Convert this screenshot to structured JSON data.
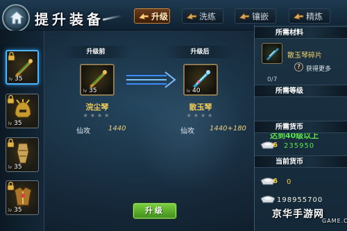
{
  "header": {
    "title": "提升装备",
    "tabs": [
      {
        "label": "升级",
        "active": true
      },
      {
        "label": "洗练",
        "active": false
      },
      {
        "label": "镶嵌",
        "active": false
      },
      {
        "label": "精炼",
        "active": false
      }
    ]
  },
  "inventory": [
    {
      "level": "35",
      "selected": true
    },
    {
      "level": "35",
      "selected": false
    },
    {
      "level": "35",
      "selected": false
    },
    {
      "level": "35",
      "selected": false
    }
  ],
  "upgrade": {
    "before": {
      "section_label": "升级前",
      "level": "35",
      "name": "浣尘琴",
      "stars": "★★★★",
      "stat_label": "仙攻",
      "stat_value": "1440"
    },
    "after": {
      "section_label": "升级后",
      "level": "40",
      "name": "散玉琴",
      "stars": "★★★★",
      "stat_label": "仙攻",
      "stat_value": "1440+180"
    },
    "button_label": "升级"
  },
  "requirements": {
    "materials_header": "所需材料",
    "material_name": "散玉琴碎片",
    "get_more_label": "获得更多",
    "help_mark": "?",
    "material_count": "0/7",
    "level_header": "所需等级",
    "level_text": "达到40级以上",
    "cost_header": "所需货币",
    "cost_value": "235950",
    "cost_badge": "6",
    "current_header": "当前货币",
    "current_badge_a": "6",
    "current_value_a": "0",
    "current_value_b": "198955700"
  },
  "watermark": {
    "main": "京华手游网",
    "sub": "GAME.COM"
  },
  "colors": {
    "accent_orange": "#c58a3e",
    "gold_text": "#f4cc5a",
    "green_text": "#5be64b",
    "button_green": "#5fae2d",
    "select_blue": "#4fb7ff"
  }
}
